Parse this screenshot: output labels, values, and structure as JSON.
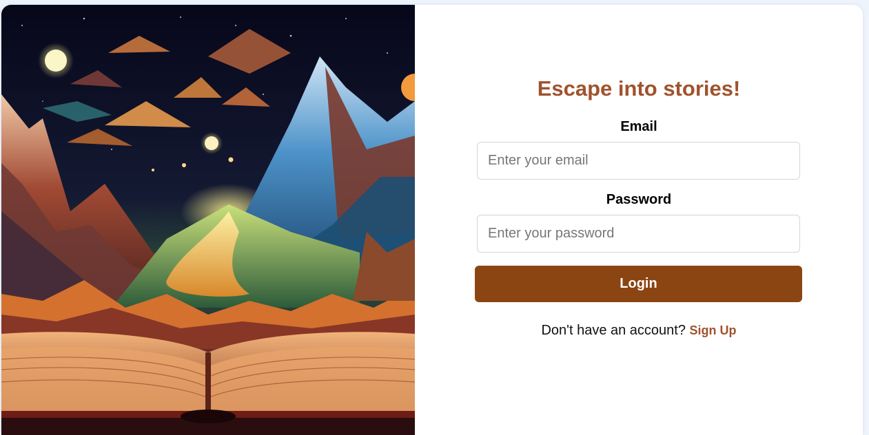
{
  "colors": {
    "accent": "#a0522d",
    "button": "#8b4513",
    "page_background": "#eef4fb"
  },
  "hero": {
    "image": "open-book-fantasy-mountains-illustration"
  },
  "login": {
    "title": "Escape into stories!",
    "email_label": "Email",
    "email_placeholder": "Enter your email",
    "email_value": "",
    "password_label": "Password",
    "password_placeholder": "Enter your password",
    "password_value": "",
    "login_button": "Login",
    "signup_prompt": "Don't have an account?",
    "signup_link": "Sign Up"
  }
}
